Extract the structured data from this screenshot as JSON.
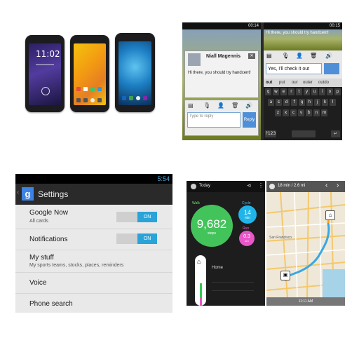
{
  "phones": {
    "lock_time": "11:02",
    "icon_colors": [
      "#e74c3c",
      "#f1c40f",
      "#2ecc71",
      "#3498db"
    ]
  },
  "messaging": {
    "status_time_left": "00:14",
    "status_time_right": "00:15",
    "contact_name": "Niall Magennis",
    "message": "Hi there, you should try handcent!",
    "reply_placeholder": "Type to reply",
    "reply_button": "Reply",
    "typed_text": "Yes, I'll check it out",
    "suggestions": [
      "out",
      "put",
      "our",
      "outer",
      "outdo"
    ],
    "keyboard_rows": [
      [
        "q",
        "w",
        "e",
        "r",
        "t",
        "y",
        "u",
        "i",
        "o",
        "p"
      ],
      [
        "a",
        "s",
        "d",
        "f",
        "g",
        "h",
        "j",
        "k",
        "l"
      ],
      [
        "z",
        "x",
        "c",
        "v",
        "b",
        "n",
        "m"
      ]
    ],
    "mode_key": "?123"
  },
  "settings": {
    "status_time": "5:54",
    "title": "Settings",
    "rows": [
      {
        "title": "Google Now",
        "subtitle": "All cards",
        "toggle": "ON"
      },
      {
        "title": "Notifications",
        "subtitle": "",
        "toggle": "ON"
      },
      {
        "title": "My stuff",
        "subtitle": "My sports teams, stocks, places, reminders",
        "toggle": ""
      },
      {
        "title": "Voice",
        "subtitle": "",
        "toggle": ""
      },
      {
        "title": "Phone search",
        "subtitle": "",
        "toggle": ""
      }
    ]
  },
  "fitness": {
    "header": "Today",
    "steps_value": "9,682",
    "steps_label": "Walk",
    "steps_unit": "steps",
    "cycle_label": "Cycle",
    "cycle_value": "14",
    "cycle_unit": "min",
    "run_label": "Run",
    "run_value": "0.3",
    "run_unit": "km",
    "home_label": "Home"
  },
  "map": {
    "route_info": "18 min / 2.6 mi",
    "city_label": "San Francisco",
    "bottom_label": "11:11 AM"
  }
}
